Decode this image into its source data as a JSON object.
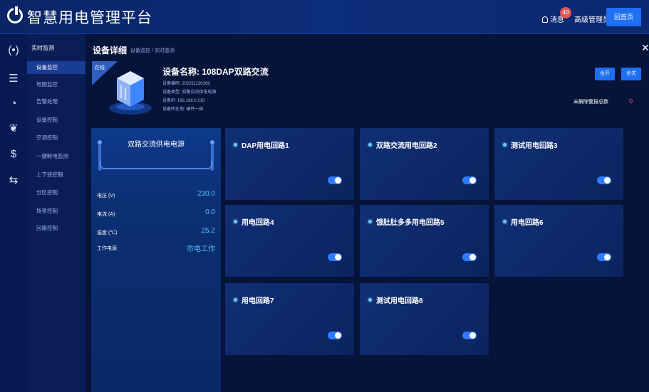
{
  "header": {
    "app_title": "智慧用电管理平台",
    "message_label": "消息",
    "message_count": "40",
    "user_label": "高级管理员 ▾",
    "back_button": "回首页"
  },
  "icon_rail": [
    "wireless-icon",
    "server-icon",
    "gauge-icon",
    "leaf-icon",
    "dollar-icon",
    "sliders-icon"
  ],
  "submenu": {
    "header": "实时监测",
    "items": [
      {
        "label": "设备监控",
        "active": true
      },
      {
        "label": "地图监控",
        "active": false
      },
      {
        "label": "告警处理",
        "active": false
      },
      {
        "label": "设备控制",
        "active": false
      },
      {
        "label": "空调控制",
        "active": false
      },
      {
        "label": "一键断电监测",
        "active": false
      },
      {
        "label": "上下班控制",
        "active": false
      },
      {
        "label": "分区控制",
        "active": false
      },
      {
        "label": "场景控制",
        "active": false
      },
      {
        "label": "回路控制",
        "active": false
      }
    ]
  },
  "page": {
    "title": "设备详细",
    "breadcrumb": "设备监控 / 实时监测",
    "close": "✕"
  },
  "device": {
    "status": "在线",
    "name": "设备名称: 108DAP双路交流",
    "code": "设备编码: 202311130269",
    "type": "设备类型: 双路交流供电电源",
    "ip": "设备IP: 192.168.0.210",
    "location": "设备所在地: 硬件一部"
  },
  "actions": {
    "all_on": "全开",
    "all_off": "全关"
  },
  "alarm": {
    "label": "未解除警报总数",
    "count": "0"
  },
  "power_panel": {
    "title": "双路交流供电电源",
    "rows": [
      {
        "label": "电压 (V)",
        "value": "230.0"
      },
      {
        "label": "电流 (A)",
        "value": "0.0"
      },
      {
        "label": "温度 (℃)",
        "value": "25.2"
      },
      {
        "label": "工作电源",
        "value": "市电工作"
      }
    ]
  },
  "circuits": [
    {
      "name": "DAP用电回路1",
      "on": true
    },
    {
      "name": "双路交流用电回路2",
      "on": true
    },
    {
      "name": "测试用电回路3",
      "on": true
    },
    {
      "name": "用电回路4",
      "on": true
    },
    {
      "name": "饿肚肚多多用电回路5",
      "on": true
    },
    {
      "name": "用电回路6",
      "on": true
    },
    {
      "name": "用电回路7",
      "on": true
    },
    {
      "name": "测试用电回路8",
      "on": true
    }
  ]
}
